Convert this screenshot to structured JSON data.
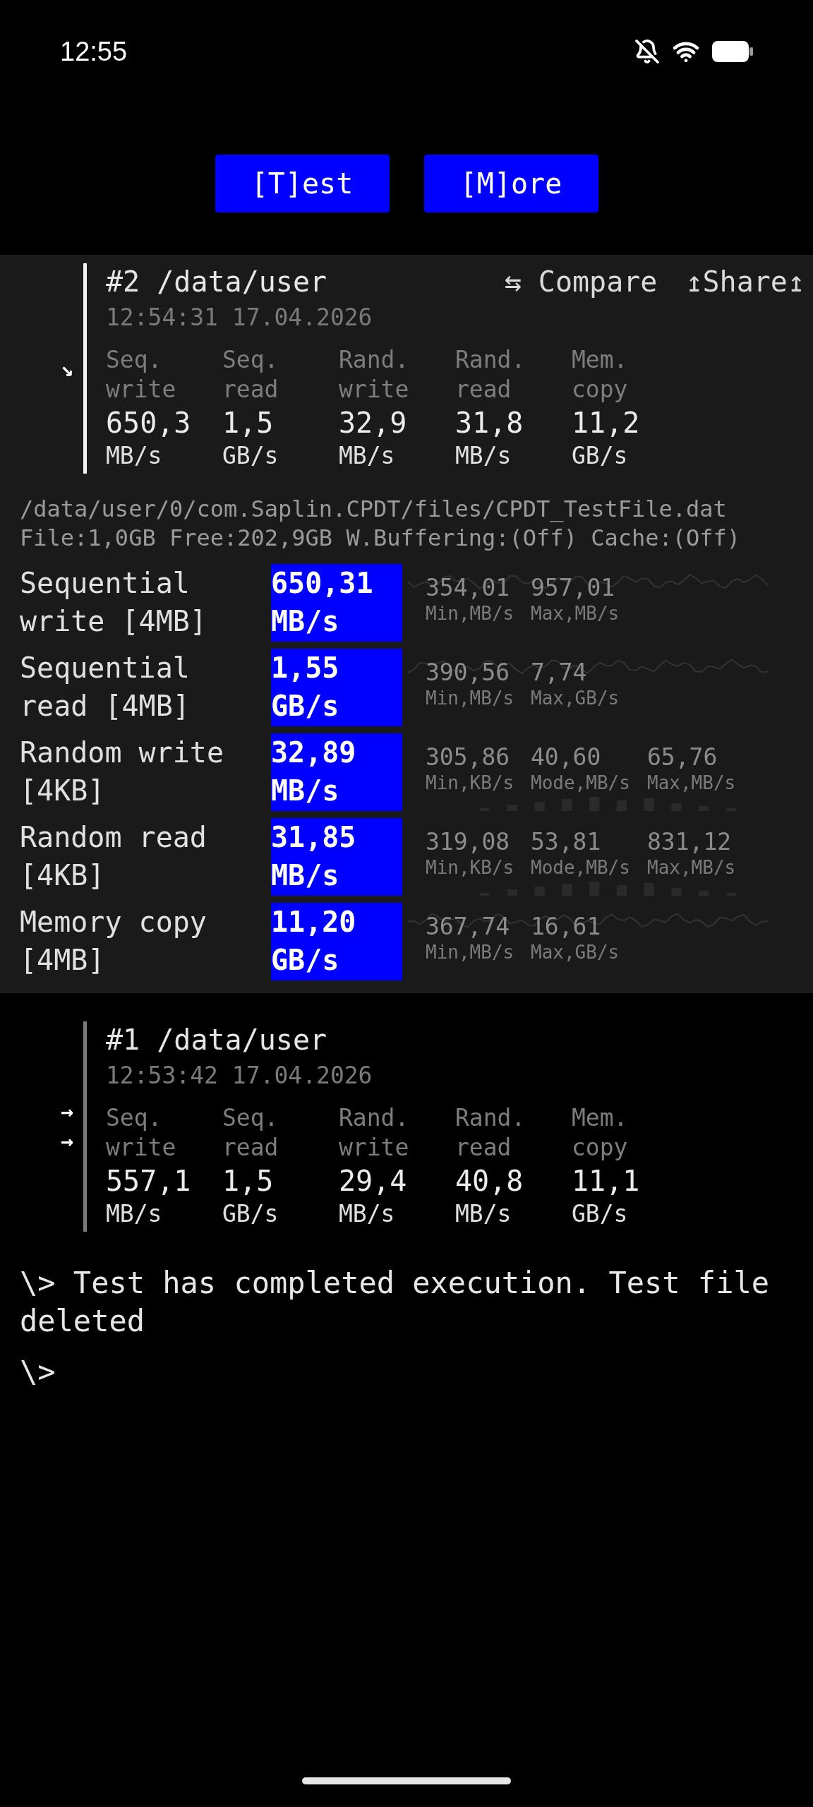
{
  "status_bar": {
    "time": "12:55"
  },
  "buttons": [
    "[T]est",
    "[M]ore"
  ],
  "results_top": [
    {
      "title": "#2 /data/user",
      "date": "12:54:31 17.04.2026",
      "selected": true,
      "markers": [
        "↘"
      ],
      "actions": [
        "⇆ Compare",
        "↥Share↥"
      ],
      "columns": [
        {
          "label": "Seq. write",
          "value": "650,3",
          "unit": "MB/s"
        },
        {
          "label": "Seq. read",
          "value": "1,5",
          "unit": "GB/s"
        },
        {
          "label": "Rand. write",
          "value": "32,9",
          "unit": "MB/s"
        },
        {
          "label": "Rand. read",
          "value": "31,8",
          "unit": "MB/s"
        },
        {
          "label": "Mem. copy",
          "value": "11,2",
          "unit": "GB/s"
        }
      ]
    }
  ],
  "file_info": [
    "/data/user/0/com.Saplin.CPDT/files/CPDT_TestFile.dat",
    "File:1,0GB Free:202,9GB W.Buffering:(Off) Cache:(Off)"
  ],
  "tests": [
    {
      "name": "Sequential write [4MB]",
      "result": "650,31 MB/s",
      "kind": "line",
      "stats": [
        {
          "value": "354,01",
          "label": "Min,MB/s"
        },
        {
          "value": "957,01",
          "label": "Max,MB/s"
        }
      ]
    },
    {
      "name": "Sequential read [4MB]",
      "result": "1,55 GB/s",
      "kind": "line",
      "stats": [
        {
          "value": "390,56",
          "label": "Min,MB/s"
        },
        {
          "value": "7,74",
          "label": "Max,GB/s"
        }
      ]
    },
    {
      "name": "Random write [4KB]",
      "result": "32,89 MB/s",
      "kind": "histogram",
      "stats": [
        {
          "value": "305,86",
          "label": "Min,KB/s"
        },
        {
          "value": "40,60",
          "label": "Mode,MB/s"
        },
        {
          "value": "65,76",
          "label": "Max,MB/s"
        }
      ]
    },
    {
      "name": "Random read [4KB]",
      "result": "31,85 MB/s",
      "kind": "histogram",
      "stats": [
        {
          "value": "319,08",
          "label": "Min,KB/s"
        },
        {
          "value": "53,81",
          "label": "Mode,MB/s"
        },
        {
          "value": "831,12",
          "label": "Max,MB/s"
        }
      ]
    },
    {
      "name": "Memory copy [4MB]",
      "result": "11,20 GB/s",
      "kind": "line",
      "stats": [
        {
          "value": "367,74",
          "label": "Min,MB/s"
        },
        {
          "value": "16,61",
          "label": "Max,GB/s"
        }
      ]
    }
  ],
  "results_bottom": [
    {
      "title": "#1 /data/user",
      "date": "12:53:42 17.04.2026",
      "selected": false,
      "markers": [
        "→",
        "→"
      ],
      "columns": [
        {
          "label": "Seq. write",
          "value": "557,1",
          "unit": "MB/s"
        },
        {
          "label": "Seq. read",
          "value": "1,5",
          "unit": "GB/s"
        },
        {
          "label": "Rand. write",
          "value": "29,4",
          "unit": "MB/s"
        },
        {
          "label": "Rand. read",
          "value": "40,8",
          "unit": "MB/s"
        },
        {
          "label": "Mem. copy",
          "value": "11,1",
          "unit": "GB/s"
        }
      ]
    }
  ],
  "console": [
    "\\> Test has completed execution. Test file deleted",
    "\\>"
  ]
}
